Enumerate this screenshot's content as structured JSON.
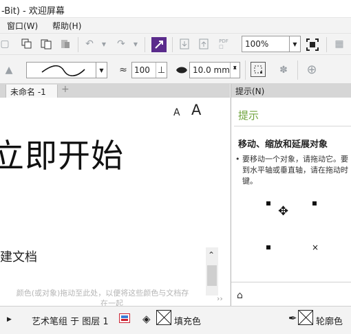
{
  "window": {
    "title": "-Bit) - 欢迎屏幕"
  },
  "menu": {
    "items": [
      "窗口(W)",
      "帮助(H)"
    ]
  },
  "toolbar": {
    "zoom_value": "100%"
  },
  "property_bar": {
    "smooth_value": "100",
    "width_value": "10.0 mm"
  },
  "tabs": {
    "active_label": "未命名 -1",
    "add_label": "+"
  },
  "canvas": {
    "font_small": "A",
    "font_large": "A",
    "heading": "立即开始",
    "new_doc": "建文档",
    "faded_line1": "颜色(或对象)拖动至此处，以便将这些颜色与文档存",
    "faded_line2": "在一起"
  },
  "panel": {
    "header": "提示(N)",
    "title": "提示",
    "subtitle": "移动、缩放和延展对象",
    "body_lines": [
      "• 要移动一个对象，请拖动它。要",
      "到水平轴或垂直轴，请在拖动时",
      "键。"
    ]
  },
  "status": {
    "tool_text": "艺术笔组 于 图层 1",
    "fill_label": "填充色",
    "outline_label": "轮廓色"
  },
  "colors": {
    "accent": "#6ea33b",
    "brand_purple": "#5a2b8c"
  }
}
